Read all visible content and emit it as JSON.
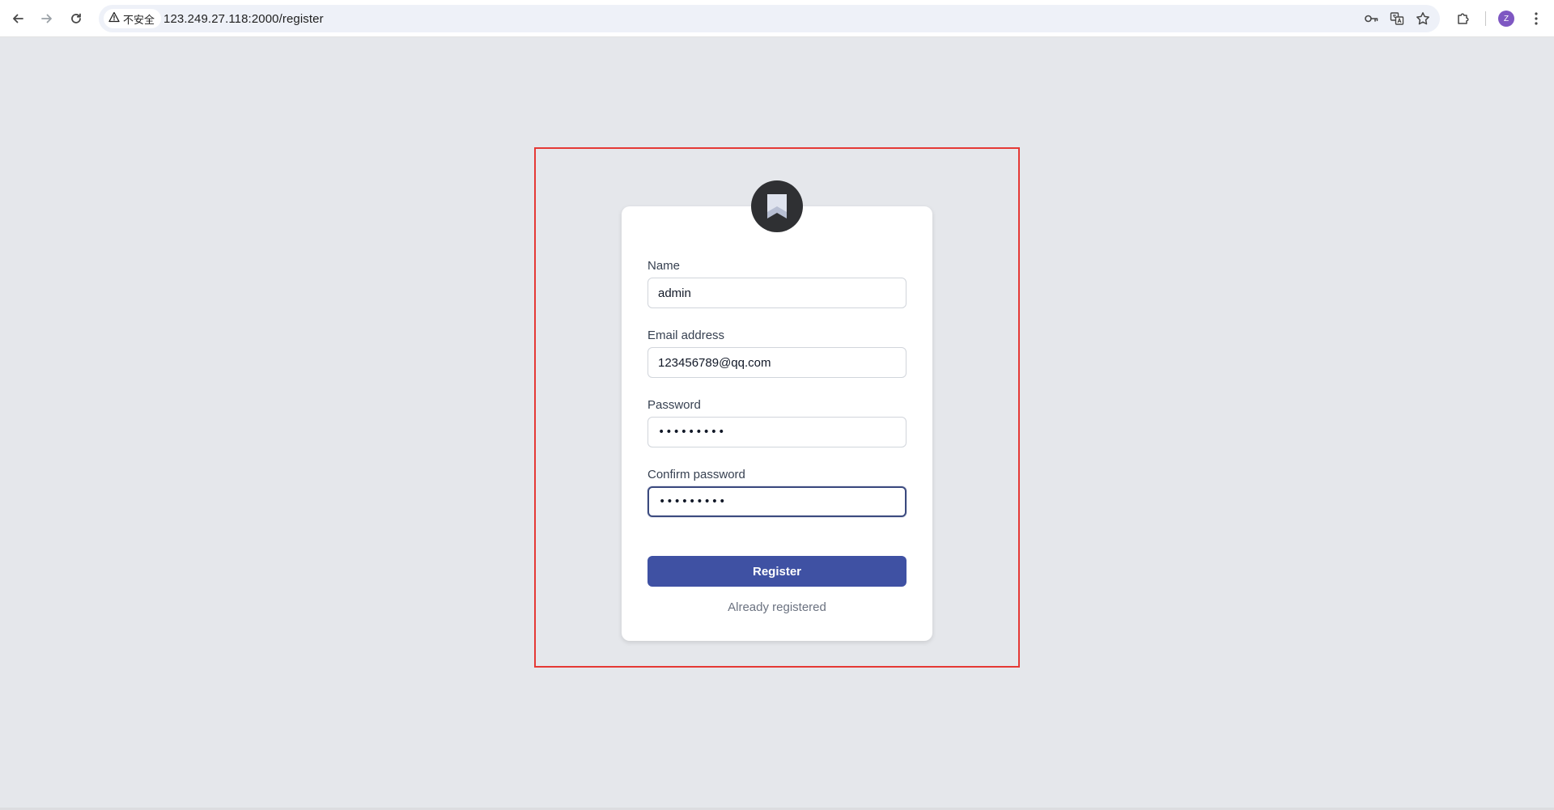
{
  "browser": {
    "security_label": "不安全",
    "url": "123.249.27.118:2000/register",
    "avatar_letter": "Z"
  },
  "form": {
    "name_label": "Name",
    "name_value": "admin",
    "email_label": "Email address",
    "email_value": "123456789@qq.com",
    "password_label": "Password",
    "password_value": "•••••••••",
    "confirm_label": "Confirm password",
    "confirm_value": "•••••••••",
    "register_label": "Register",
    "already_label": "Already registered"
  },
  "colors": {
    "page_bg": "#e5e7eb",
    "primary_button": "#3f51a3",
    "highlight_frame": "#e53935",
    "logo_bg": "#2f3033"
  },
  "icons": {
    "back": "back-arrow-icon",
    "forward": "forward-arrow-icon",
    "reload": "reload-icon",
    "warning": "warning-icon",
    "password_key": "key-icon",
    "translate": "translate-icon",
    "bookmark_star": "star-icon",
    "extensions": "puzzle-icon",
    "menu": "kebab-menu-icon",
    "logo": "bookmark-logo-icon"
  }
}
